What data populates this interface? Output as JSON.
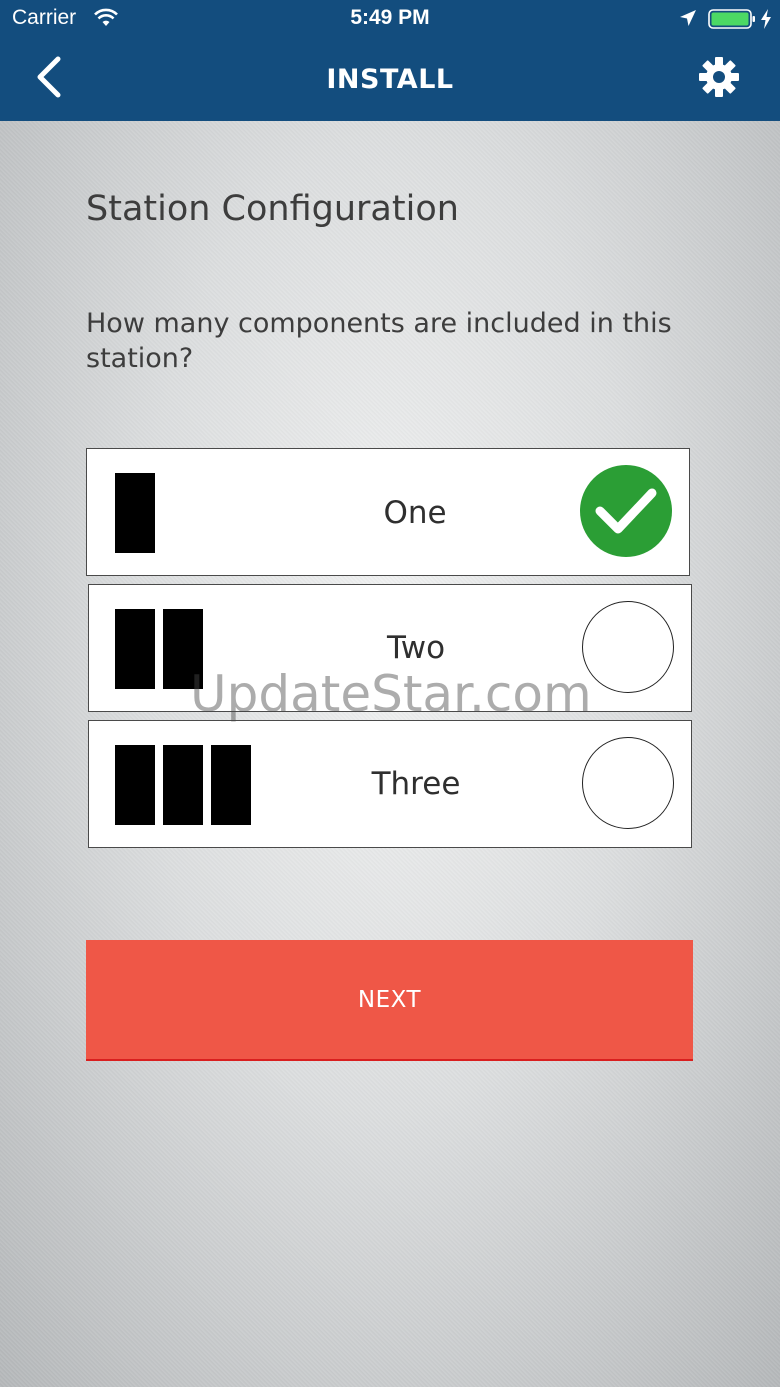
{
  "status_bar": {
    "carrier": "Carrier",
    "time": "5:49 PM",
    "wifi_icon": "wifi-icon",
    "location_icon": "location-arrow-icon",
    "battery_icon": "battery-icon",
    "charge_icon": "charging-bolt-icon",
    "battery_color": "#4cd964"
  },
  "nav": {
    "title": "INSTALL",
    "back_icon": "chevron-left-icon",
    "settings_icon": "gear-icon",
    "background_color": "#134d7e"
  },
  "main": {
    "heading": "Station Configuration",
    "question": "How many components are included in this station?",
    "options": [
      {
        "label": "One",
        "blocks": 1,
        "selected": true
      },
      {
        "label": "Two",
        "blocks": 2,
        "selected": false
      },
      {
        "label": "Three",
        "blocks": 3,
        "selected": false
      }
    ],
    "selected_color": "#2b9e35",
    "watermark": "UpdateStar.com"
  },
  "footer": {
    "next_label": "NEXT",
    "button_color": "#ef5747"
  }
}
